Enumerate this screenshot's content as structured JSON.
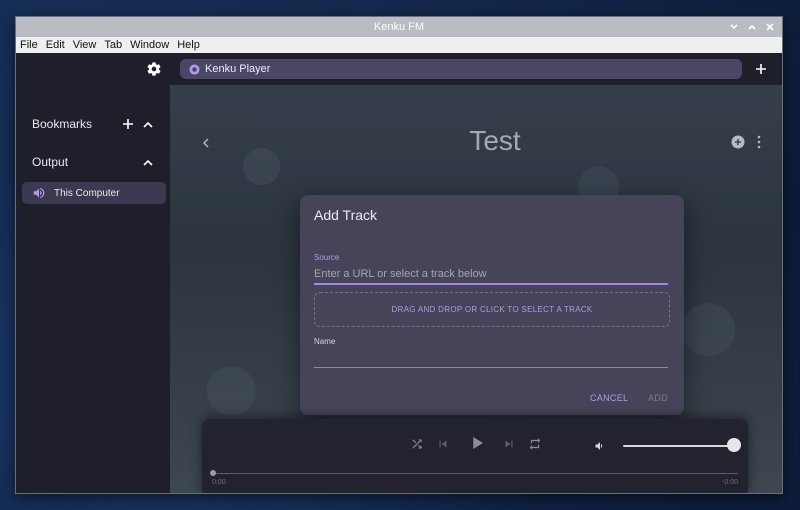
{
  "window": {
    "title": "Kenku FM"
  },
  "menu": [
    "File",
    "Edit",
    "View",
    "Tab",
    "Window",
    "Help"
  ],
  "sidebar": {
    "bookmarks_label": "Bookmarks",
    "output_label": "Output",
    "output_items": [
      {
        "label": "This Computer"
      }
    ]
  },
  "tabs": [
    {
      "label": "Kenku Player"
    }
  ],
  "board": {
    "title": "Test"
  },
  "dialog": {
    "title": "Add Track",
    "source_label": "Source",
    "source_placeholder": "Enter a URL or select a track below",
    "dropzone_text": "DRAG AND DROP OR CLICK TO SELECT A TRACK",
    "name_label": "Name",
    "cancel_label": "CANCEL",
    "add_label": "ADD"
  },
  "player": {
    "current_time": "0:00",
    "remaining_time": "-0:00",
    "volume": 1.0
  },
  "colors": {
    "accent": "#b29ae8",
    "dialog_bg": "#454459",
    "app_bg": "#1f1f2b"
  },
  "icons": [
    "settings-gear-icon",
    "plus-icon",
    "chevron-up-icon",
    "speaker-icon",
    "tab-kenku-icon",
    "chevron-left-icon",
    "add-circle-icon",
    "more-vert-icon",
    "shuffle-icon",
    "skip-previous-icon",
    "play-icon",
    "skip-next-icon",
    "repeat-icon",
    "volume-icon"
  ]
}
